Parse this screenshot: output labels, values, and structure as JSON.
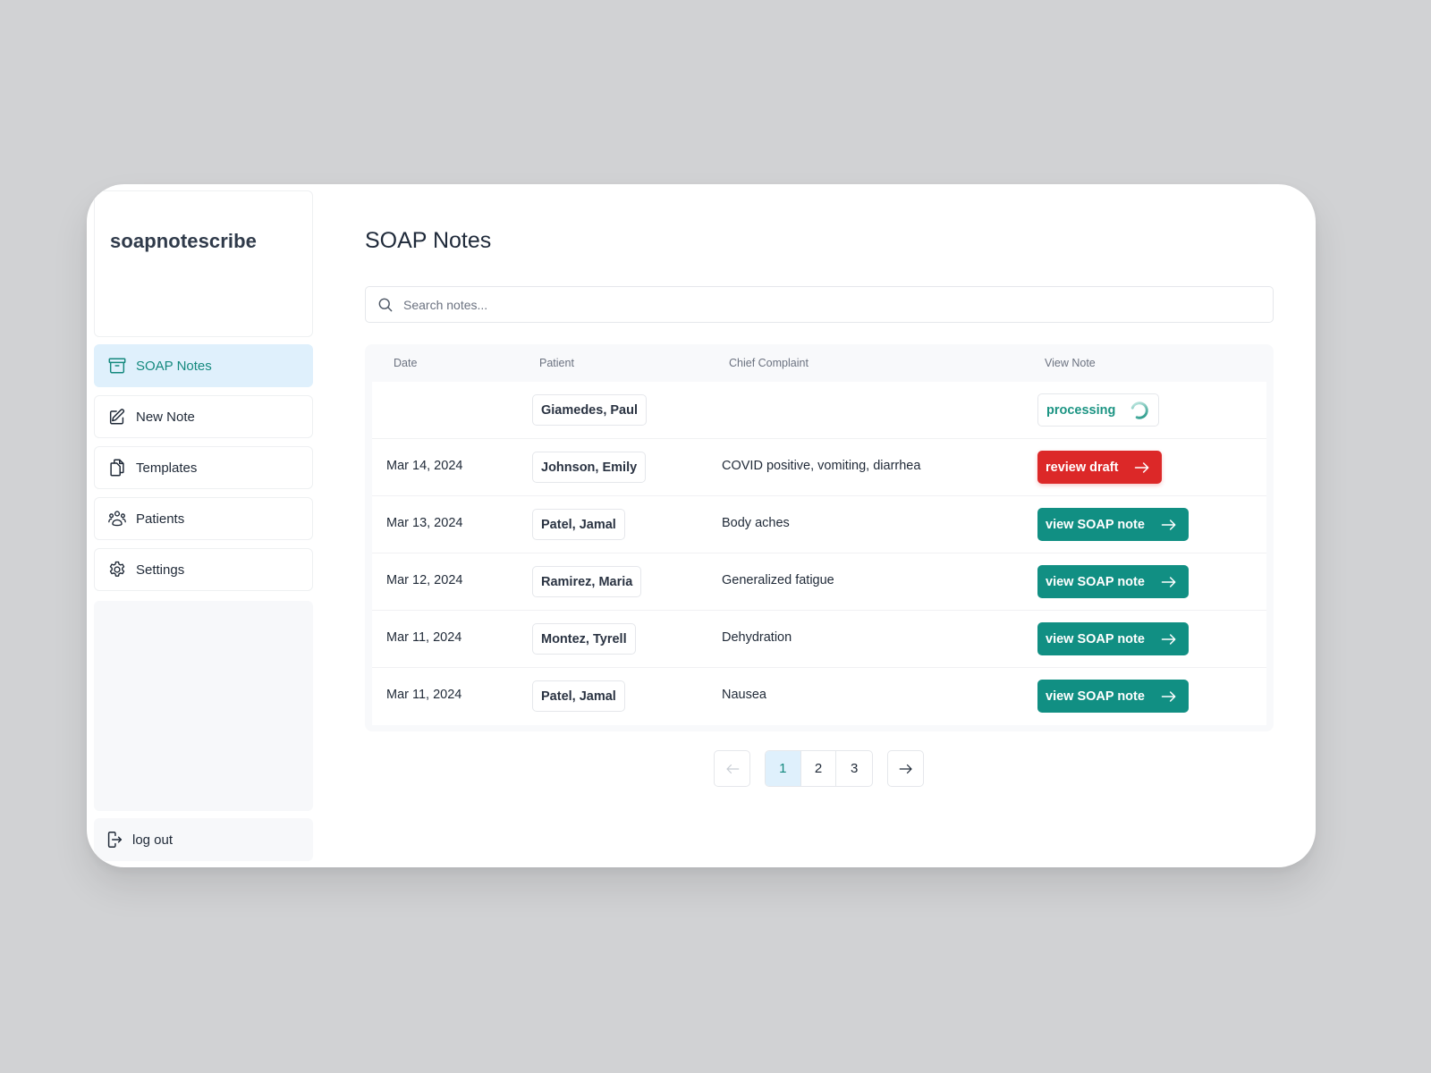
{
  "app": {
    "brand": "soapnotescribe"
  },
  "sidebar": {
    "items": [
      {
        "label": "SOAP Notes",
        "icon": "archive-box-icon",
        "active": true
      },
      {
        "label": "New Note",
        "icon": "pencil-square-icon",
        "active": false
      },
      {
        "label": "Templates",
        "icon": "documents-icon",
        "active": false
      },
      {
        "label": "Patients",
        "icon": "users-group-icon",
        "active": false
      },
      {
        "label": "Settings",
        "icon": "gear-icon",
        "active": false
      }
    ],
    "logout_label": "log out"
  },
  "main": {
    "title": "SOAP Notes",
    "search": {
      "placeholder": "Search notes...",
      "value": ""
    },
    "table": {
      "columns": [
        "Date",
        "Patient",
        "Chief Complaint",
        "View Note"
      ],
      "rows": [
        {
          "date": "",
          "patient": "Giamedes, Paul",
          "complaint": "",
          "action": {
            "type": "processing",
            "label": "processing"
          }
        },
        {
          "date": "Mar 14, 2024",
          "patient": "Johnson, Emily",
          "complaint": "COVID positive, vomiting, diarrhea",
          "action": {
            "type": "review",
            "label": "review draft"
          }
        },
        {
          "date": "Mar 13, 2024",
          "patient": "Patel, Jamal",
          "complaint": "Body aches",
          "action": {
            "type": "view",
            "label": "view SOAP note"
          }
        },
        {
          "date": "Mar 12, 2024",
          "patient": "Ramirez, Maria",
          "complaint": "Generalized fatigue",
          "action": {
            "type": "view",
            "label": "view SOAP note"
          }
        },
        {
          "date": "Mar 11, 2024",
          "patient": "Montez, Tyrell",
          "complaint": "Dehydration",
          "action": {
            "type": "view",
            "label": "view SOAP note"
          }
        },
        {
          "date": "Mar 11, 2024",
          "patient": "Patel, Jamal",
          "complaint": "Nausea",
          "action": {
            "type": "view",
            "label": "view SOAP note"
          }
        }
      ]
    },
    "pagination": {
      "pages": [
        "1",
        "2",
        "3"
      ],
      "current": "1",
      "prev_disabled": true
    }
  },
  "colors": {
    "accent_teal": "#118f83",
    "danger_red": "#dc2828",
    "active_nav_bg": "#dff0fc",
    "background": "#d1d2d4"
  }
}
